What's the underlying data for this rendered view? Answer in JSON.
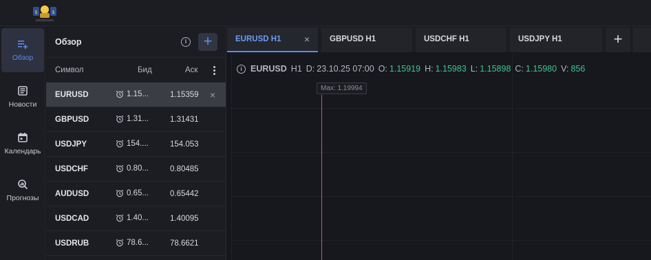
{
  "brand": {
    "logo_text": "PROFITRACE"
  },
  "rail": {
    "items": [
      {
        "label": "Обзор",
        "icon": "playlist-add-icon",
        "active": true
      },
      {
        "label": "Новости",
        "icon": "newspaper-icon"
      },
      {
        "label": "Календарь",
        "icon": "calendar-icon"
      },
      {
        "label": "Прогнозы",
        "icon": "forecast-search-icon"
      }
    ]
  },
  "watch": {
    "title": "Обзор",
    "add": "+",
    "info": "i",
    "col_symbol": "Символ",
    "col_bid": "Бид",
    "col_ask": "Аск",
    "remove": "×",
    "rows": [
      {
        "symbol": "EURUSD",
        "bid": "1.15...",
        "ask": "1.15359"
      },
      {
        "symbol": "GBPUSD",
        "bid": "1.31...",
        "ask": "1.31431"
      },
      {
        "symbol": "USDJPY",
        "bid": "154....",
        "ask": "154.053"
      },
      {
        "symbol": "USDCHF",
        "bid": "0.80...",
        "ask": "0.80485"
      },
      {
        "symbol": "AUDUSD",
        "bid": "0.65...",
        "ask": "0.65442"
      },
      {
        "symbol": "USDCAD",
        "bid": "1.40...",
        "ask": "1.40095"
      },
      {
        "symbol": "USDRUB",
        "bid": "78.6...",
        "ask": "78.6621"
      }
    ]
  },
  "tabs": {
    "items": [
      {
        "label": "EURUSD H1",
        "close": "×"
      },
      {
        "label": "GBPUSD H1"
      },
      {
        "label": "USDCHF H1"
      },
      {
        "label": "USDJPY H1"
      }
    ],
    "add": "+"
  },
  "chart": {
    "info": "i",
    "symbol": "EURUSD",
    "timeframe": "H1",
    "d_label": "D:",
    "date": "23.10.25 07:00",
    "o_label": "O:",
    "open": "1.15919",
    "h_label": "H:",
    "high": "1.15983",
    "l_label": "L:",
    "low": "1.15898",
    "c_label": "C:",
    "close": "1.15980",
    "v_label": "V:",
    "volume": "856",
    "max_label": "Max: 1.19994",
    "value_color": "#3ec48d",
    "marker_color": "#e25353"
  }
}
